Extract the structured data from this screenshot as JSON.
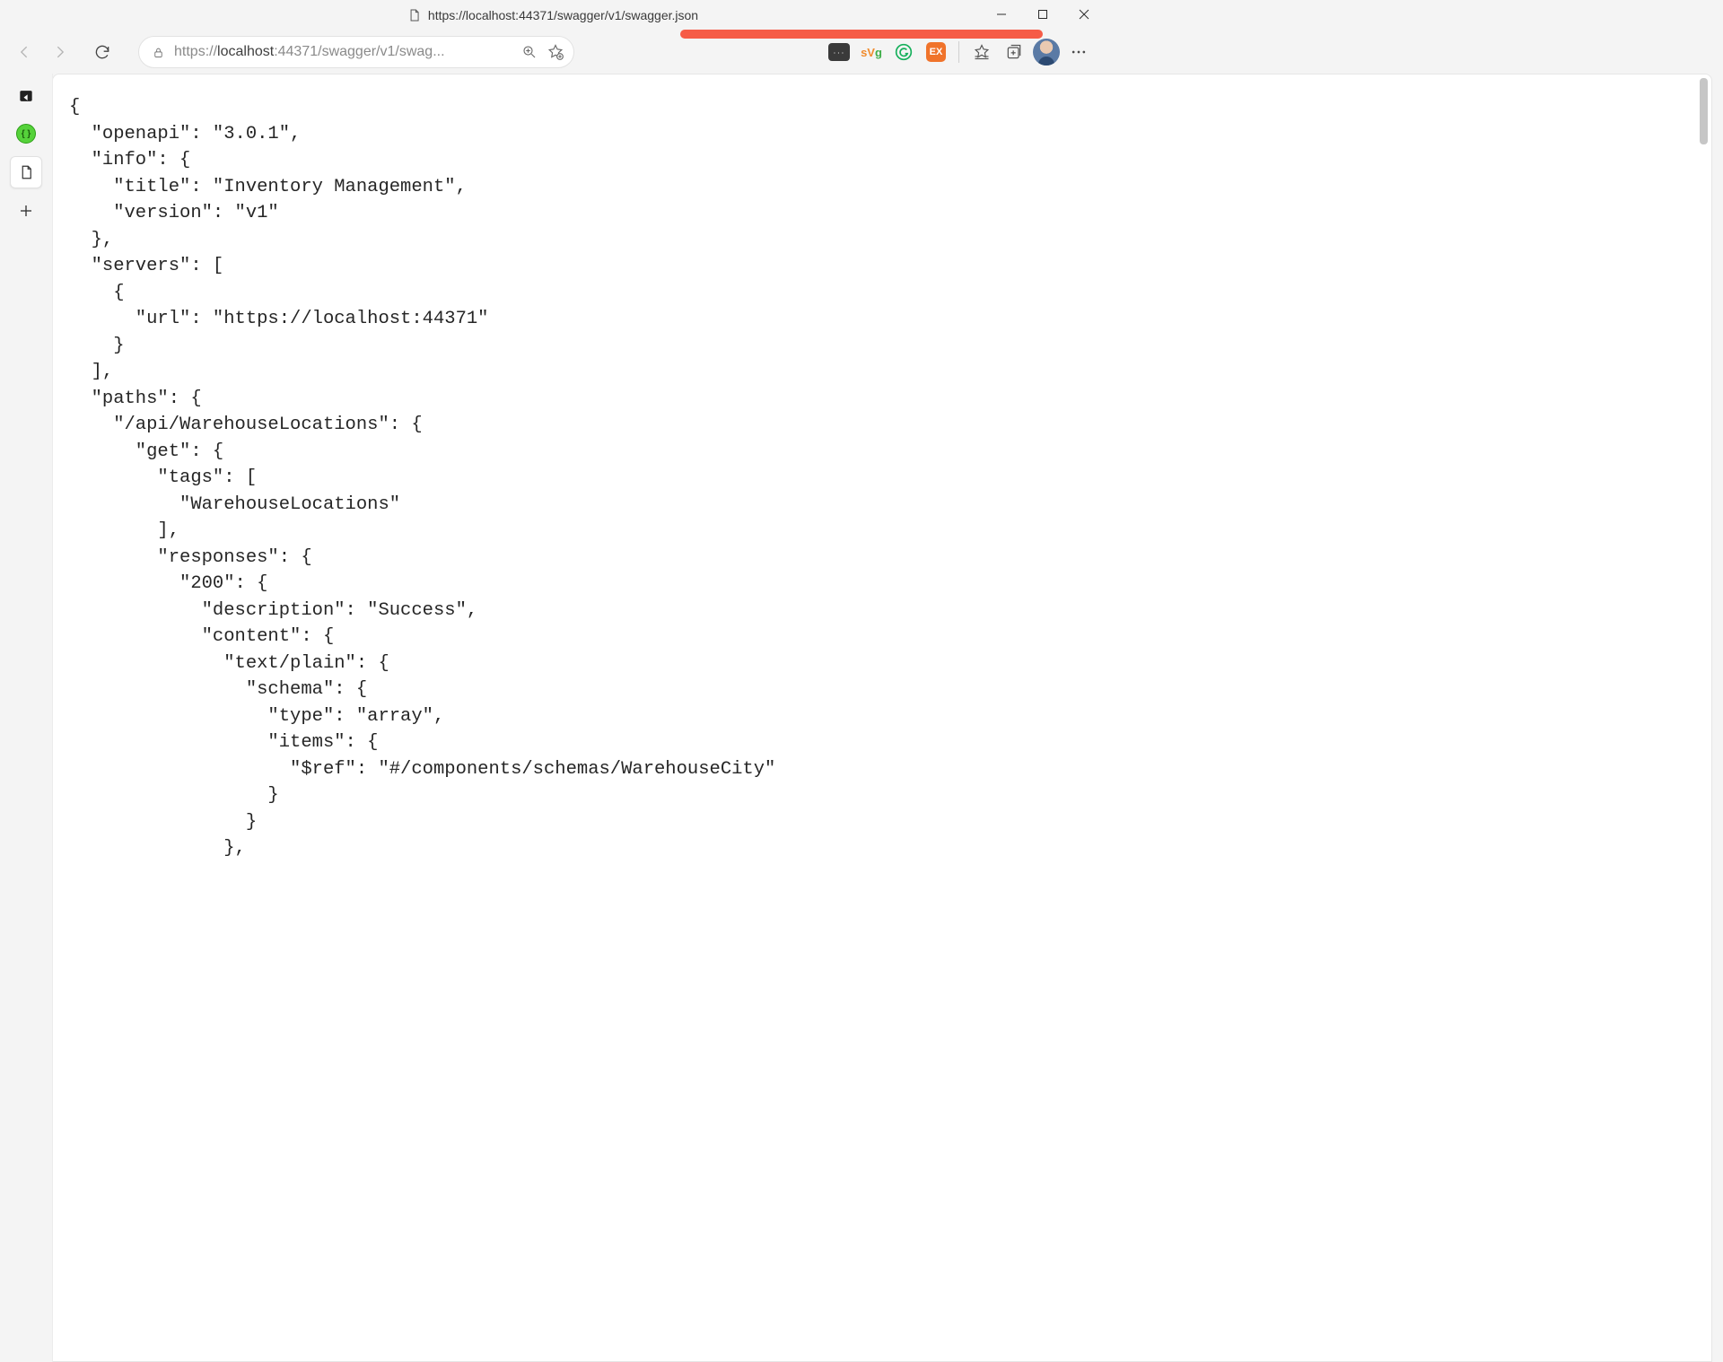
{
  "window": {
    "title_url": "https://localhost:44371/swagger/v1/swagger.json"
  },
  "address": {
    "scheme": "https://",
    "host": "localhost",
    "rest_truncated": ":44371/swagger/v1/swag..."
  },
  "ext": {
    "lp_dots": "• • •",
    "svg_text": "sVg",
    "ex_text": "EX"
  },
  "json_body": "{\n  \"openapi\": \"3.0.1\",\n  \"info\": {\n    \"title\": \"Inventory Management\",\n    \"version\": \"v1\"\n  },\n  \"servers\": [\n    {\n      \"url\": \"https://localhost:44371\"\n    }\n  ],\n  \"paths\": {\n    \"/api/WarehouseLocations\": {\n      \"get\": {\n        \"tags\": [\n          \"WarehouseLocations\"\n        ],\n        \"responses\": {\n          \"200\": {\n            \"description\": \"Success\",\n            \"content\": {\n              \"text/plain\": {\n                \"schema\": {\n                  \"type\": \"array\",\n                  \"items\": {\n                    \"$ref\": \"#/components/schemas/WarehouseCity\"\n                  }\n                }\n              },"
}
